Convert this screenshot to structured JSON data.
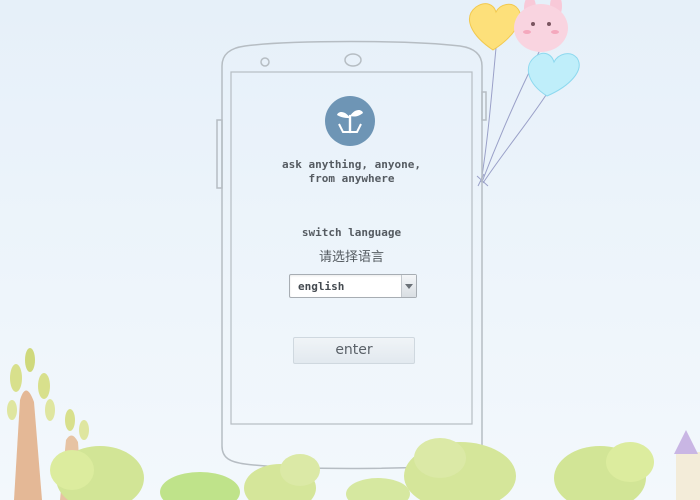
{
  "tagline": {
    "line1": "ask anything, anyone,",
    "line2": "from anywhere"
  },
  "language": {
    "switch_label": "switch language",
    "switch_label_cn": "请选择语言",
    "selected": "english"
  },
  "enter_label": "enter",
  "colors": {
    "logo": "#6e95b5",
    "phone_outline": "#b6bdc3",
    "text": "#555b61"
  },
  "icons": [
    "sprout-logo-icon",
    "dropdown-arrow-icon"
  ]
}
